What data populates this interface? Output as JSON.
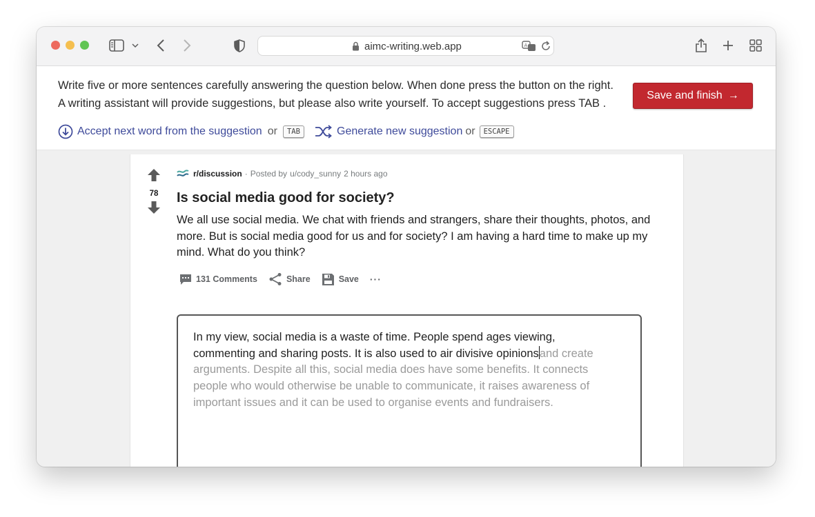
{
  "browser": {
    "url": "aimc-writing.web.app",
    "icons": {
      "sidebar": "sidebar-icon",
      "back": "chevron-left-icon",
      "forward": "chevron-right-icon",
      "privacy": "shield-icon",
      "lock": "lock-icon",
      "translate": "translate-icon",
      "reload": "reload-icon",
      "share": "share-icon",
      "new_tab": "plus-icon",
      "tab_overview": "grid-icon"
    }
  },
  "instructions": {
    "line1": "Write five or more sentences carefully answering the question below. When done press the button on the right.",
    "line2": "A writing assistant will provide suggestions, but please also write yourself. To accept suggestions press TAB .",
    "save_button": "Save and finish",
    "save_arrow": "→",
    "hint_accept": "Accept next word from the suggestion",
    "hint_or_1": "or",
    "key_tab": "TAB",
    "hint_generate": "Generate new suggestion",
    "hint_or_2": "or",
    "key_escape": "ESCAPE"
  },
  "post": {
    "vote_count": "78",
    "subreddit": "r/discussion",
    "separator": "·",
    "posted_by": "Posted by",
    "author": "u/cody_sunny",
    "time": "2 hours ago",
    "title": "Is social media good for society?",
    "body": "We all use social media. We chat with friends and strangers, share their thoughts, photos, and more. But is social media good for us and for society? I am having a hard time to make up my mind. What do you think?",
    "actions": {
      "comments": "131 Comments",
      "share": "Share",
      "save": "Save",
      "more": "···"
    }
  },
  "editor": {
    "typed_text": "In my view, social media is a waste of time. People spend ages viewing, commenting and sharing posts. It is also used to air divisive opinions",
    "suggestion_text": "and create arguments. Despite all this, social media does have some benefits. It connects people who would otherwise be unable to communicate, it raises awareness of important issues and it can be used to organise events and fundraisers."
  },
  "colors": {
    "accent_button": "#c2282f",
    "hint_link": "#3e4a9a",
    "suggestion_gray": "#9a9a9a"
  }
}
